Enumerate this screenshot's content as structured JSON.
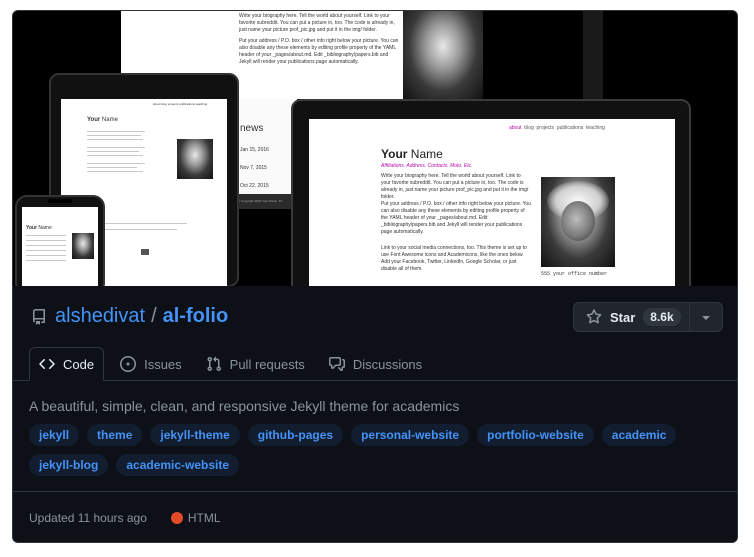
{
  "repo": {
    "owner": "alshedivat",
    "name": "al-folio",
    "separator": "/",
    "description": "A beautiful, simple, clean, and responsive Jekyll theme for academics",
    "star_label": "Star",
    "star_count": "8.6k",
    "updated": "Updated 11 hours ago",
    "language": "HTML",
    "language_color": "#e34c26"
  },
  "tabs": [
    {
      "label": "Code",
      "icon": "code-icon"
    },
    {
      "label": "Issues",
      "icon": "issue-icon"
    },
    {
      "label": "Pull requests",
      "icon": "pull-request-icon"
    },
    {
      "label": "Discussions",
      "icon": "discussions-icon"
    }
  ],
  "topics": [
    "jekyll",
    "theme",
    "jekyll-theme",
    "github-pages",
    "personal-website",
    "portfolio-website",
    "academic",
    "jekyll-blog",
    "academic-website"
  ],
  "hero": {
    "nav": [
      "about",
      "blog",
      "projects",
      "publications",
      "teaching"
    ],
    "name_first": "Your",
    "name_last": "Name",
    "subtitle": "Affiliations. Address. Contacts. Moto. Etc.",
    "bio_1": "Write your biography here. Tell the world about yourself. Link to your favorite subreddit. You can put a picture in, too. The code is already in, just name your picture prof_pic.jpg and put it in the img/ folder.",
    "bio_2": "Put your address / P.O. box / other info right below your picture. You can also disable any these elements by editing profile property of the YAML header of your _pages/about.md. Edit _bibliography/papers.bib and Jekyll will render your publications page automatically.",
    "bio_3": "Link to your social media connections, too. This theme is set up to use Font Awesome icons and Academicons, like the ones below. Add your Facebook, Twitter, LinkedIn, Google Scholar, or just disable all of them.",
    "news_heading": "news",
    "news_dates": [
      "Jan 15, 2016",
      "Nov 7, 2015",
      "Oct 22, 2015"
    ],
    "footer": "© Copyright 2024 Your Name. Po",
    "address": "555 your office number"
  },
  "colors": {
    "link": "#4493f8",
    "muted": "#8b949e",
    "text": "#e6edf3",
    "border": "#30363d",
    "bg": "#0d1117"
  }
}
